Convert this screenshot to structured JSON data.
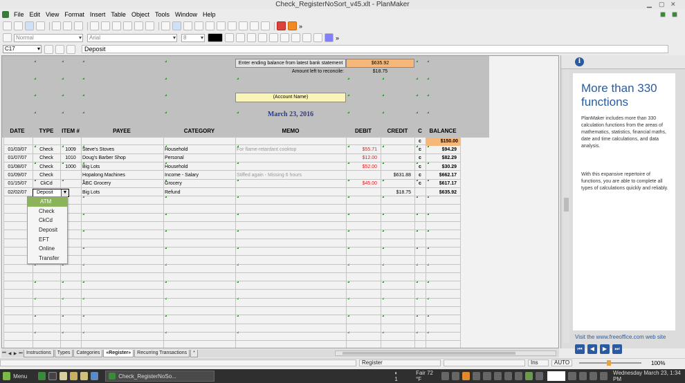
{
  "window": {
    "title": "Check_RegisterNoSort_v45.xlt - PlanMaker"
  },
  "menu": [
    "File",
    "Edit",
    "View",
    "Format",
    "Insert",
    "Table",
    "Object",
    "Tools",
    "Window",
    "Help"
  ],
  "format_bar": {
    "style": "Normal",
    "font": "Arial",
    "size": "8"
  },
  "formula_bar": {
    "cell_ref": "C17",
    "content": "Deposit"
  },
  "statement": {
    "ending_label": "Enter ending balance from latest bank statement",
    "ending_value": "$635.92",
    "left_label": "Amount left to reconcile:",
    "left_value": "$18.75",
    "account_name": "(Account Name)",
    "date": "March 23, 2016"
  },
  "columns": [
    "DATE",
    "TYPE",
    "ITEM #",
    "PAYEE",
    "CATEGORY",
    "MEMO",
    "DEBIT",
    "CREDIT",
    "C",
    "BALANCE"
  ],
  "opening": {
    "c": "c",
    "balance": "$150.00"
  },
  "rows": [
    {
      "date": "01/03/07",
      "type": "Check",
      "item": "1009",
      "payee": "Steve's Stoves",
      "category": "Household",
      "memo": "For flame-retardant cooktop",
      "debit": "$55.71",
      "credit": "",
      "c": "c",
      "balance": "$94.29"
    },
    {
      "date": "01/07/07",
      "type": "Check",
      "item": "1010",
      "payee": "Doug's Barber Shop",
      "category": "Personal",
      "memo": "",
      "debit": "$12.00",
      "credit": "",
      "c": "c",
      "balance": "$82.29"
    },
    {
      "date": "01/08/07",
      "type": "Check",
      "item": "1000",
      "payee": "Big Lots",
      "category": "Household",
      "memo": "",
      "debit": "$52.00",
      "credit": "",
      "c": "c",
      "balance": "$30.29"
    },
    {
      "date": "01/09/07",
      "type": "Check",
      "item": "",
      "payee": "Hopalong Machines",
      "category": "Income - Salary",
      "memo": "Stiffed again - Missing 6 hours",
      "debit": "",
      "credit": "$631.88",
      "c": "c",
      "balance": "$662.17"
    },
    {
      "date": "01/15/07",
      "type": "CkCd",
      "item": "",
      "payee": "ABC Grocery",
      "category": "Grocery",
      "memo": "",
      "debit": "$45.00",
      "credit": "",
      "c": "c",
      "balance": "$617.17"
    },
    {
      "date": "02/02/07",
      "type": "Deposit",
      "item": "",
      "payee": "Big Lots",
      "category": "Refund",
      "memo": "",
      "debit": "",
      "credit": "$18.75",
      "c": "",
      "balance": "$635.92"
    }
  ],
  "dropdown_options": [
    "ATM",
    "Check",
    "CkCd",
    "Deposit",
    "EFT",
    "Online",
    "Transfer"
  ],
  "sheet_tabs": [
    "Instructions",
    "Types",
    "Categories",
    "«Register»",
    "Recurring Transactions",
    "*"
  ],
  "status": {
    "mode": "Register",
    "ins": "Ins",
    "auto": "AUTO",
    "zoom": "100%"
  },
  "sidebar": {
    "title": "More than 330 functions",
    "text1": "PlanMaker includes more than 330 calculation functions from the areas of mathematics, statistics, financial maths, date and time calculations, and data analysis.",
    "text2": "With this expansive repertoire of functions, you are able to complete all types of calculations quickly and reliably.",
    "link": "Visit the www.freeoffice.com web site"
  },
  "taskbar": {
    "menu": "Menu",
    "app": "Check_RegisterNoSo...",
    "workspace": "1",
    "weather": "Fair 72 °F",
    "clock": "Wednesday March 23,  1:34 PM"
  }
}
